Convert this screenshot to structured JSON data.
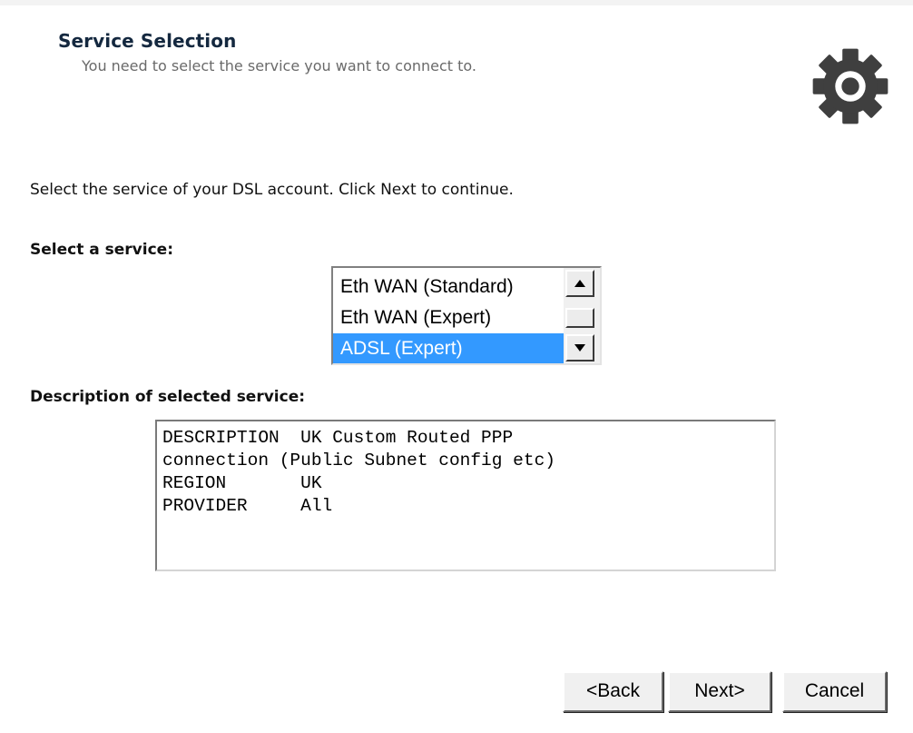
{
  "header": {
    "title": "Service Selection",
    "subtitle": "You need to select the service you want to connect to.",
    "icon": "gear-icon"
  },
  "intro_text": "Select the service of your DSL account. Click Next to continue.",
  "service_select": {
    "label": "Select a service:",
    "items": [
      {
        "label": "Eth WAN (Standard)",
        "selected": false
      },
      {
        "label": "Eth WAN (Expert)",
        "selected": false
      },
      {
        "label": "ADSL (Expert)",
        "selected": true
      }
    ]
  },
  "description": {
    "label": "Description of selected service:",
    "lines": [
      "DESCRIPTION  UK Custom Routed PPP",
      "connection (Public Subnet config etc)",
      "REGION       UK",
      "PROVIDER     All"
    ]
  },
  "buttons": {
    "back": "<Back",
    "next": "Next>",
    "cancel": "Cancel"
  },
  "colors": {
    "selection": "#3399ff",
    "title": "#14283f",
    "subtitle": "#6a6a6a",
    "gear": "#3f3f3f"
  }
}
